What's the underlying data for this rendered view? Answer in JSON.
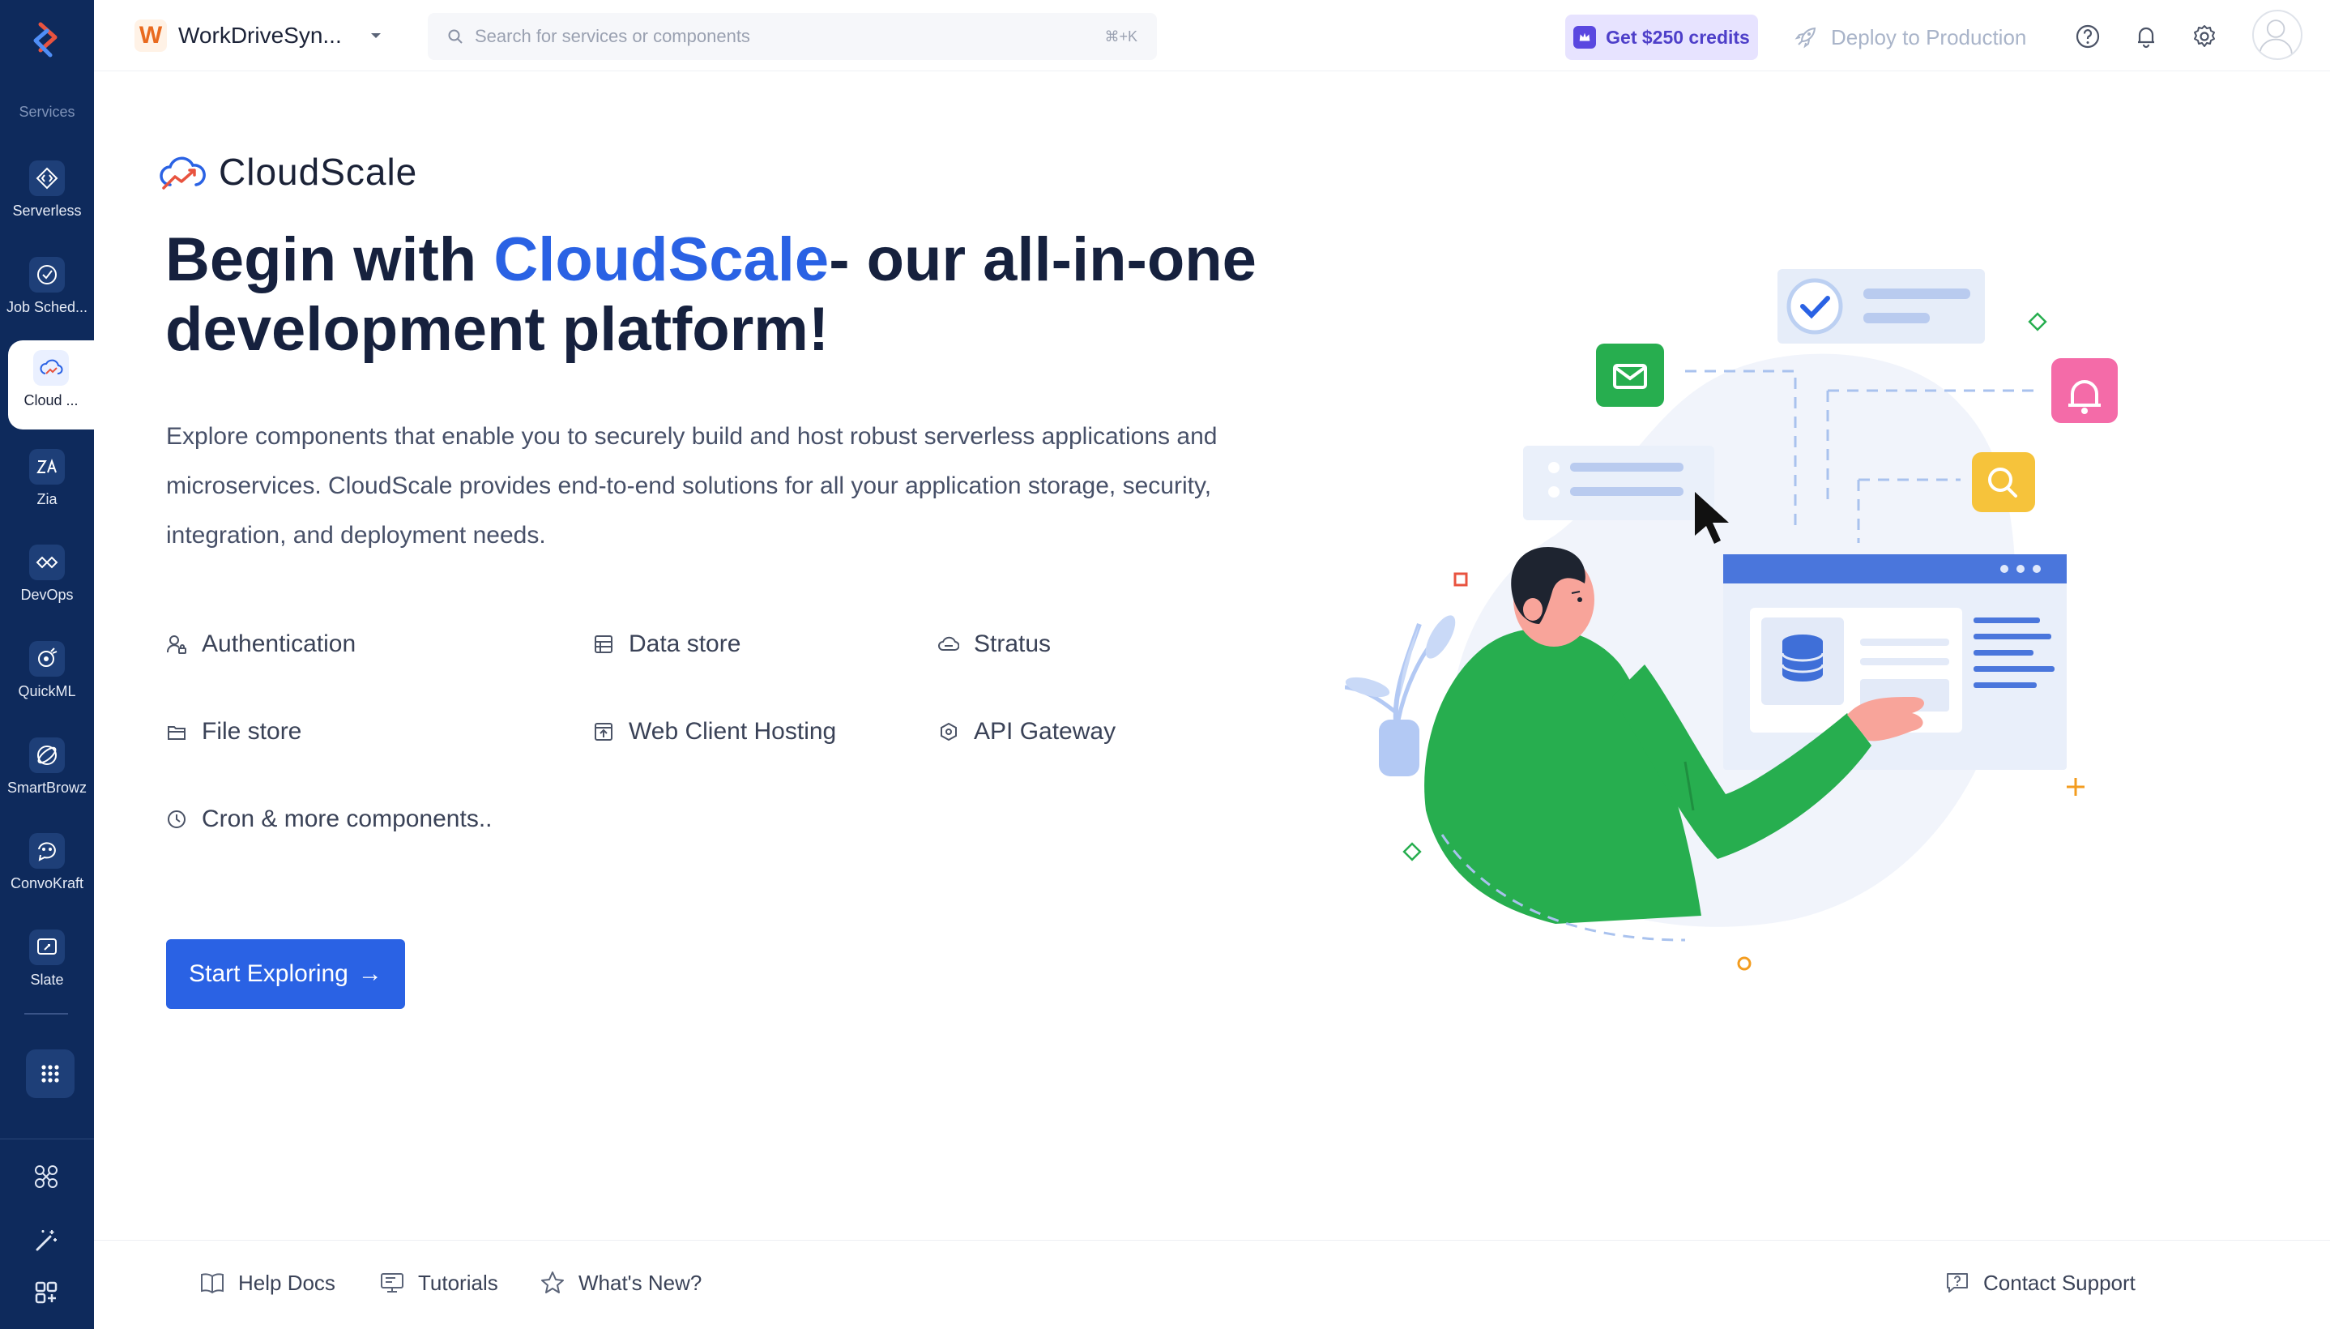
{
  "sidebar": {
    "section_label": "Services",
    "items": [
      {
        "label": "Serverless",
        "icon": "serverless-icon"
      },
      {
        "label": "Job Sched...",
        "icon": "job-scheduling-icon"
      },
      {
        "label": "Cloud ...",
        "icon": "cloudscale-icon",
        "active": true
      },
      {
        "label": "Zia",
        "icon": "zia-icon"
      },
      {
        "label": "DevOps",
        "icon": "devops-icon"
      },
      {
        "label": "QuickML",
        "icon": "quickml-icon"
      },
      {
        "label": "SmartBrowz",
        "icon": "smartbrowz-icon"
      },
      {
        "label": "ConvoKraft",
        "icon": "convokraft-icon"
      },
      {
        "label": "Slate",
        "icon": "slate-icon"
      }
    ],
    "tools": [
      "integrations-icon",
      "magic-wand-icon",
      "add-widgets-icon"
    ]
  },
  "header": {
    "project_initial": "W",
    "project_name": "WorkDriveSyn...",
    "search_placeholder": "Search for services or components",
    "search_shortcut": "⌘+K",
    "credits_label": "Get $250 credits",
    "deploy_label": "Deploy to Production"
  },
  "main": {
    "brand_name": "CloudScale",
    "headline_prefix": "Begin with ",
    "headline_highlight": "CloudScale",
    "headline_suffix": "- our all-in-one development platform!",
    "description": "Explore components that enable you to securely build and host robust serverless applications and microservices. CloudScale provides end-to-end solutions for all your application storage, security, integration, and deployment needs.",
    "components": [
      {
        "label": "Authentication",
        "icon": "authentication-icon"
      },
      {
        "label": "Data store",
        "icon": "data-store-icon"
      },
      {
        "label": "Stratus",
        "icon": "stratus-icon"
      },
      {
        "label": "File store",
        "icon": "file-store-icon"
      },
      {
        "label": "Web Client Hosting",
        "icon": "web-client-hosting-icon"
      },
      {
        "label": "API Gateway",
        "icon": "api-gateway-icon"
      },
      {
        "label": "Cron & more components..",
        "icon": "cron-icon"
      }
    ],
    "cta_label": "Start Exploring",
    "cta_arrow": "→"
  },
  "footer": {
    "help_docs": "Help Docs",
    "tutorials": "Tutorials",
    "whats_new": "What's New?",
    "contact_support": "Contact Support"
  },
  "colors": {
    "sidebar_bg": "#0e2a5c",
    "primary": "#2a62e4",
    "highlight": "#f6c62c",
    "credits_bg": "#e7e3ff",
    "illustration_green": "#27ae4f"
  }
}
